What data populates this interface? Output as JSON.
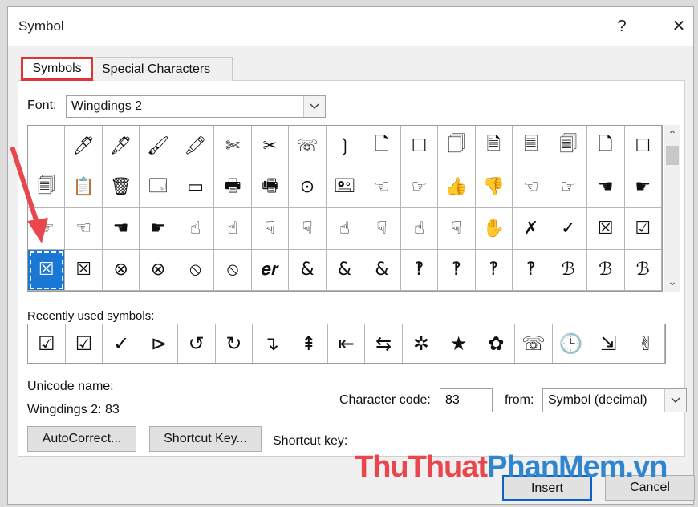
{
  "window": {
    "title": "Symbol",
    "help_glyph": "?",
    "close_glyph": "✕"
  },
  "tabs": [
    {
      "label": "Symbols",
      "active": true
    },
    {
      "label": "Special Characters",
      "active": false
    }
  ],
  "font": {
    "label": "Font:",
    "value": "Wingdings 2"
  },
  "symbols_grid": {
    "rows": [
      [
        "",
        "🖊",
        "🖋",
        "🖌",
        "🖍",
        "✄",
        "✂",
        "☏",
        "❳",
        "🗋",
        "☐",
        "🗍",
        "🗎",
        "🗏",
        "🗐",
        "🗋",
        "☐"
      ],
      [
        "🗐",
        "📋",
        "🗑",
        "🗔",
        "▭",
        "🖶",
        "🖷",
        "⊙",
        "🖭",
        "☜",
        "☞",
        "👍",
        "👎",
        "☜",
        "☞",
        "☚",
        "☛"
      ],
      [
        "☞",
        "☜",
        "☚",
        "☛",
        "☝",
        "☝",
        "☟",
        "☟",
        "☝",
        "☟",
        "☝",
        "☟",
        "✋",
        "✗",
        "✓",
        "☒",
        "☑"
      ],
      [
        "☒",
        "☒",
        "⊗",
        "⊗",
        "⦸",
        "⦸",
        "𝒆𝒓",
        "&",
        "&",
        "&",
        "‽",
        "‽",
        "‽",
        "‽",
        "ℬ",
        "ℬ",
        "ℬ"
      ]
    ],
    "selected": "3,0",
    "selected_glyph": "☒"
  },
  "recent": {
    "label": "Recently used symbols:",
    "items": [
      "☑",
      "☑",
      "✓",
      "⊳",
      "↺",
      "↻",
      "↴",
      "⇞",
      "⇤",
      "⇆",
      "✲",
      "★",
      "✿",
      "☏",
      "🕒",
      "⇲",
      "✌"
    ]
  },
  "unicode": {
    "name_label": "Unicode name:",
    "name_value": "Wingdings 2: 83"
  },
  "char_code": {
    "label": "Character code:",
    "value": "83"
  },
  "from": {
    "label": "from:",
    "value": "Symbol (decimal)"
  },
  "buttons": {
    "autocorrect": "AutoCorrect...",
    "shortcut_key": "Shortcut Key...",
    "insert": "Insert",
    "cancel": "Cancel"
  },
  "shortcut_key_label": "Shortcut key:",
  "watermark": {
    "part1": "ThuThuat",
    "part2": "PhanMem.vn"
  },
  "colors": {
    "selection": "#1a78d4",
    "tab_highlight": "#e03535",
    "arrow": "#e8474d"
  }
}
